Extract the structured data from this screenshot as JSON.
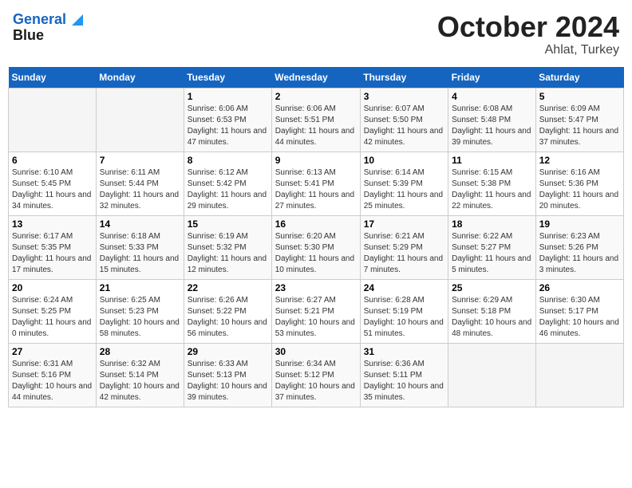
{
  "header": {
    "logo_line1": "General",
    "logo_line2": "Blue",
    "month": "October 2024",
    "location": "Ahlat, Turkey"
  },
  "weekdays": [
    "Sunday",
    "Monday",
    "Tuesday",
    "Wednesday",
    "Thursday",
    "Friday",
    "Saturday"
  ],
  "weeks": [
    [
      {
        "day": "",
        "sunrise": "",
        "sunset": "",
        "daylight": ""
      },
      {
        "day": "",
        "sunrise": "",
        "sunset": "",
        "daylight": ""
      },
      {
        "day": "1",
        "sunrise": "Sunrise: 6:06 AM",
        "sunset": "Sunset: 6:53 PM",
        "daylight": "Daylight: 11 hours and 47 minutes."
      },
      {
        "day": "2",
        "sunrise": "Sunrise: 6:06 AM",
        "sunset": "Sunset: 5:51 PM",
        "daylight": "Daylight: 11 hours and 44 minutes."
      },
      {
        "day": "3",
        "sunrise": "Sunrise: 6:07 AM",
        "sunset": "Sunset: 5:50 PM",
        "daylight": "Daylight: 11 hours and 42 minutes."
      },
      {
        "day": "4",
        "sunrise": "Sunrise: 6:08 AM",
        "sunset": "Sunset: 5:48 PM",
        "daylight": "Daylight: 11 hours and 39 minutes."
      },
      {
        "day": "5",
        "sunrise": "Sunrise: 6:09 AM",
        "sunset": "Sunset: 5:47 PM",
        "daylight": "Daylight: 11 hours and 37 minutes."
      }
    ],
    [
      {
        "day": "6",
        "sunrise": "Sunrise: 6:10 AM",
        "sunset": "Sunset: 5:45 PM",
        "daylight": "Daylight: 11 hours and 34 minutes."
      },
      {
        "day": "7",
        "sunrise": "Sunrise: 6:11 AM",
        "sunset": "Sunset: 5:44 PM",
        "daylight": "Daylight: 11 hours and 32 minutes."
      },
      {
        "day": "8",
        "sunrise": "Sunrise: 6:12 AM",
        "sunset": "Sunset: 5:42 PM",
        "daylight": "Daylight: 11 hours and 29 minutes."
      },
      {
        "day": "9",
        "sunrise": "Sunrise: 6:13 AM",
        "sunset": "Sunset: 5:41 PM",
        "daylight": "Daylight: 11 hours and 27 minutes."
      },
      {
        "day": "10",
        "sunrise": "Sunrise: 6:14 AM",
        "sunset": "Sunset: 5:39 PM",
        "daylight": "Daylight: 11 hours and 25 minutes."
      },
      {
        "day": "11",
        "sunrise": "Sunrise: 6:15 AM",
        "sunset": "Sunset: 5:38 PM",
        "daylight": "Daylight: 11 hours and 22 minutes."
      },
      {
        "day": "12",
        "sunrise": "Sunrise: 6:16 AM",
        "sunset": "Sunset: 5:36 PM",
        "daylight": "Daylight: 11 hours and 20 minutes."
      }
    ],
    [
      {
        "day": "13",
        "sunrise": "Sunrise: 6:17 AM",
        "sunset": "Sunset: 5:35 PM",
        "daylight": "Daylight: 11 hours and 17 minutes."
      },
      {
        "day": "14",
        "sunrise": "Sunrise: 6:18 AM",
        "sunset": "Sunset: 5:33 PM",
        "daylight": "Daylight: 11 hours and 15 minutes."
      },
      {
        "day": "15",
        "sunrise": "Sunrise: 6:19 AM",
        "sunset": "Sunset: 5:32 PM",
        "daylight": "Daylight: 11 hours and 12 minutes."
      },
      {
        "day": "16",
        "sunrise": "Sunrise: 6:20 AM",
        "sunset": "Sunset: 5:30 PM",
        "daylight": "Daylight: 11 hours and 10 minutes."
      },
      {
        "day": "17",
        "sunrise": "Sunrise: 6:21 AM",
        "sunset": "Sunset: 5:29 PM",
        "daylight": "Daylight: 11 hours and 7 minutes."
      },
      {
        "day": "18",
        "sunrise": "Sunrise: 6:22 AM",
        "sunset": "Sunset: 5:27 PM",
        "daylight": "Daylight: 11 hours and 5 minutes."
      },
      {
        "day": "19",
        "sunrise": "Sunrise: 6:23 AM",
        "sunset": "Sunset: 5:26 PM",
        "daylight": "Daylight: 11 hours and 3 minutes."
      }
    ],
    [
      {
        "day": "20",
        "sunrise": "Sunrise: 6:24 AM",
        "sunset": "Sunset: 5:25 PM",
        "daylight": "Daylight: 11 hours and 0 minutes."
      },
      {
        "day": "21",
        "sunrise": "Sunrise: 6:25 AM",
        "sunset": "Sunset: 5:23 PM",
        "daylight": "Daylight: 10 hours and 58 minutes."
      },
      {
        "day": "22",
        "sunrise": "Sunrise: 6:26 AM",
        "sunset": "Sunset: 5:22 PM",
        "daylight": "Daylight: 10 hours and 56 minutes."
      },
      {
        "day": "23",
        "sunrise": "Sunrise: 6:27 AM",
        "sunset": "Sunset: 5:21 PM",
        "daylight": "Daylight: 10 hours and 53 minutes."
      },
      {
        "day": "24",
        "sunrise": "Sunrise: 6:28 AM",
        "sunset": "Sunset: 5:19 PM",
        "daylight": "Daylight: 10 hours and 51 minutes."
      },
      {
        "day": "25",
        "sunrise": "Sunrise: 6:29 AM",
        "sunset": "Sunset: 5:18 PM",
        "daylight": "Daylight: 10 hours and 48 minutes."
      },
      {
        "day": "26",
        "sunrise": "Sunrise: 6:30 AM",
        "sunset": "Sunset: 5:17 PM",
        "daylight": "Daylight: 10 hours and 46 minutes."
      }
    ],
    [
      {
        "day": "27",
        "sunrise": "Sunrise: 6:31 AM",
        "sunset": "Sunset: 5:16 PM",
        "daylight": "Daylight: 10 hours and 44 minutes."
      },
      {
        "day": "28",
        "sunrise": "Sunrise: 6:32 AM",
        "sunset": "Sunset: 5:14 PM",
        "daylight": "Daylight: 10 hours and 42 minutes."
      },
      {
        "day": "29",
        "sunrise": "Sunrise: 6:33 AM",
        "sunset": "Sunset: 5:13 PM",
        "daylight": "Daylight: 10 hours and 39 minutes."
      },
      {
        "day": "30",
        "sunrise": "Sunrise: 6:34 AM",
        "sunset": "Sunset: 5:12 PM",
        "daylight": "Daylight: 10 hours and 37 minutes."
      },
      {
        "day": "31",
        "sunrise": "Sunrise: 6:36 AM",
        "sunset": "Sunset: 5:11 PM",
        "daylight": "Daylight: 10 hours and 35 minutes."
      },
      {
        "day": "",
        "sunrise": "",
        "sunset": "",
        "daylight": ""
      },
      {
        "day": "",
        "sunrise": "",
        "sunset": "",
        "daylight": ""
      }
    ]
  ]
}
